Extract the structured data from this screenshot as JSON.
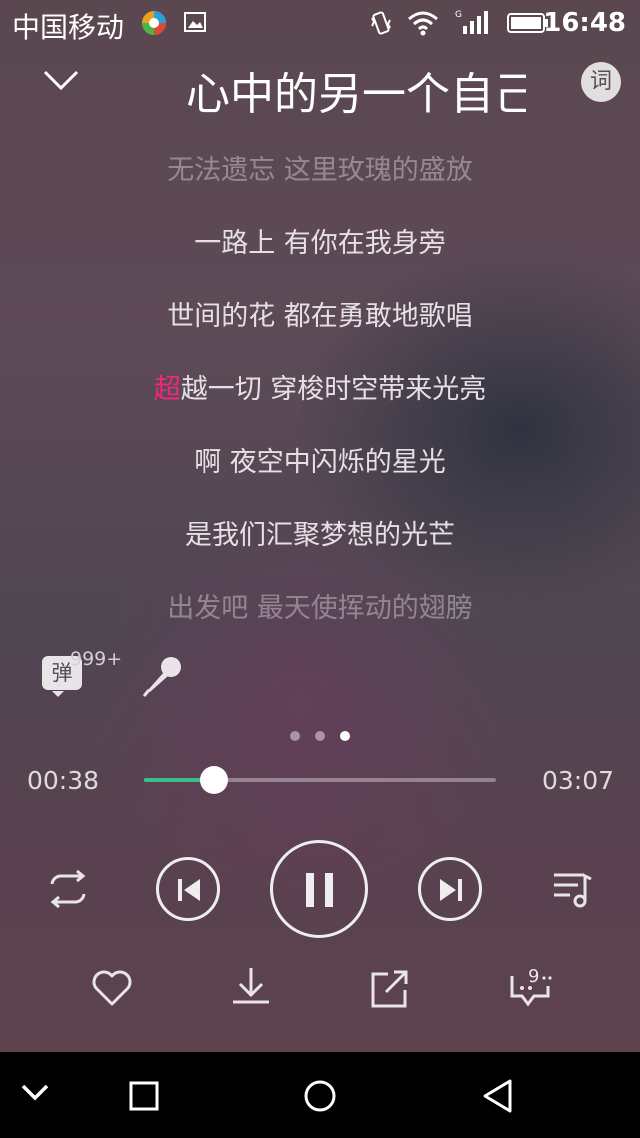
{
  "status_bar": {
    "carrier": "中国移动",
    "time": "16:48"
  },
  "header": {
    "title": "心中的另一个自己",
    "lyrics_button_label": "词"
  },
  "lyrics": [
    {
      "text": "无法遗忘 这里玫瑰的盛放",
      "state": "dim"
    },
    {
      "text": "一路上 有你在我身旁",
      "state": "normal"
    },
    {
      "text": "世间的花 都在勇敢地歌唱",
      "state": "normal"
    },
    {
      "highlight": "超",
      "rest": "越一切 穿梭时空带来光亮",
      "state": "current"
    },
    {
      "text": "啊 夜空中闪烁的星光",
      "state": "normal"
    },
    {
      "text": "是我们汇聚梦想的光芒",
      "state": "normal"
    },
    {
      "text": "出发吧 最天使挥动的翅膀",
      "state": "dim"
    }
  ],
  "comments": {
    "label": "弹",
    "count": "999+"
  },
  "page_indicator": {
    "total": 3,
    "active": 3
  },
  "progress": {
    "current": "00:38",
    "total": "03:07",
    "fraction": 0.2
  },
  "actions": {
    "comment_count": "9"
  },
  "colors": {
    "accent_green": "#3bbf86",
    "highlight_pink": "#f0287a"
  },
  "icons": {
    "collapse": "chevron-down-icon",
    "mode": "loop-icon",
    "prev": "previous-icon",
    "play_pause": "pause-icon",
    "next": "next-icon",
    "playlist": "playlist-icon",
    "favorite": "heart-icon",
    "download": "download-icon",
    "share": "share-icon",
    "comment": "comment-icon",
    "mic": "microphone-icon"
  }
}
